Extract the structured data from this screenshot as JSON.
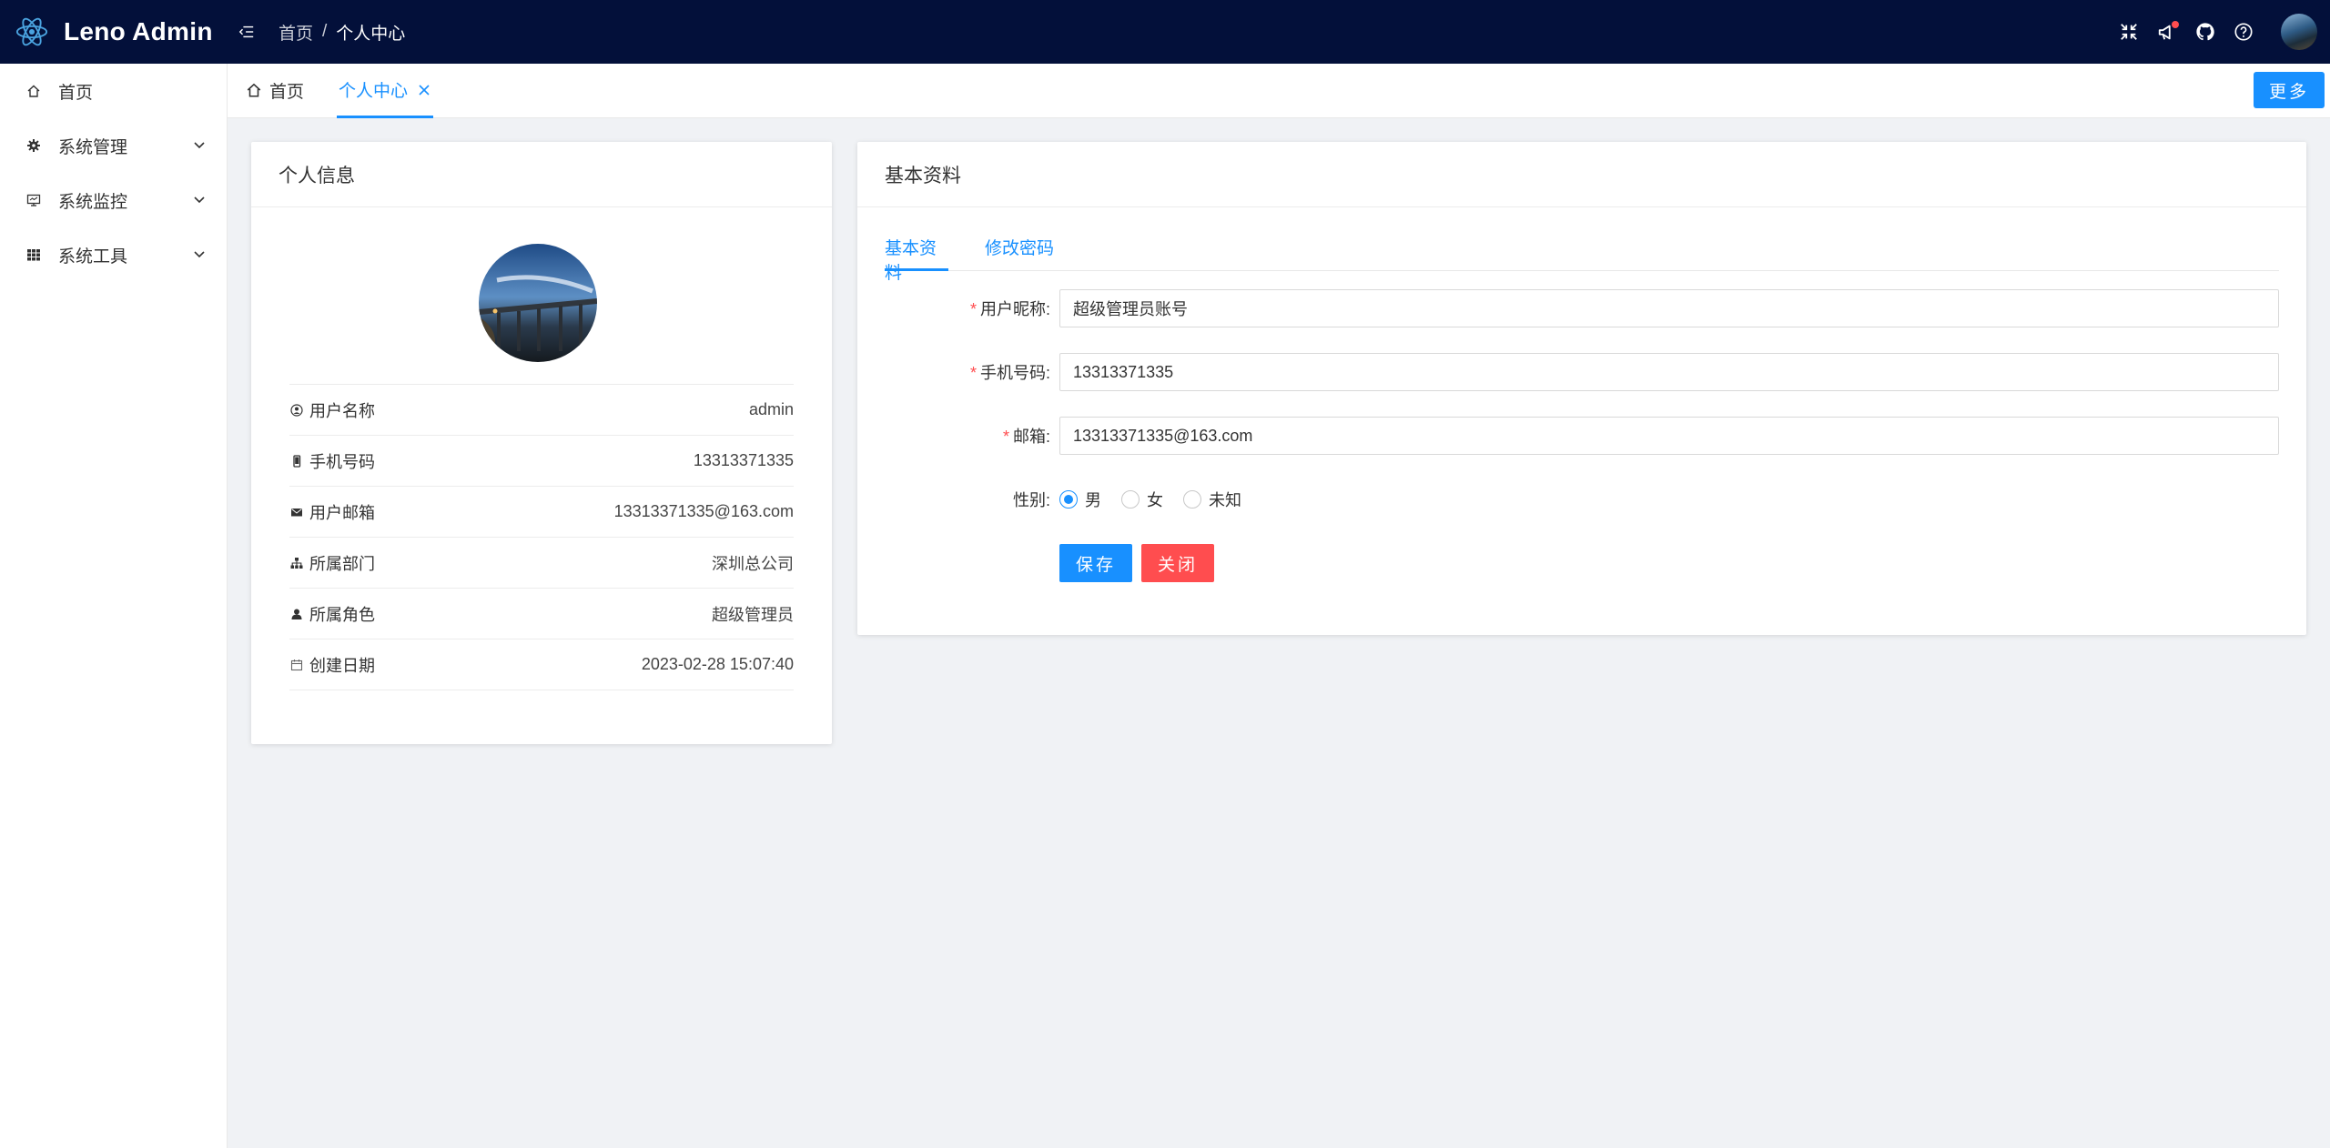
{
  "app": {
    "title": "Leno Admin",
    "colors": {
      "header_bg": "#03103a",
      "primary": "#1890ff",
      "danger": "#ff4d4f"
    }
  },
  "header": {
    "breadcrumb": {
      "home": "首页",
      "separator": "/",
      "current": "个人中心"
    },
    "icons": [
      "fullscreen-icon",
      "notification-icon",
      "github-icon",
      "help-icon"
    ],
    "has_notification_dot": true
  },
  "sidebar": {
    "items": [
      {
        "label": "首页",
        "icon": "home-icon",
        "expandable": false
      },
      {
        "label": "系统管理",
        "icon": "gear-icon",
        "expandable": true
      },
      {
        "label": "系统监控",
        "icon": "monitor-icon",
        "expandable": true
      },
      {
        "label": "系统工具",
        "icon": "grid-icon",
        "expandable": true
      }
    ]
  },
  "tabs": {
    "home": "首页",
    "active": "个人中心",
    "more_button": "更多"
  },
  "profile_card": {
    "title": "个人信息",
    "rows": [
      {
        "label": "用户名称",
        "value": "admin",
        "icon": "user-icon"
      },
      {
        "label": "手机号码",
        "value": "13313371335",
        "icon": "phone-icon"
      },
      {
        "label": "用户邮箱",
        "value": "13313371335@163.com",
        "icon": "mail-icon"
      },
      {
        "label": "所属部门",
        "value": "深圳总公司",
        "icon": "org-icon"
      },
      {
        "label": "所属角色",
        "value": "超级管理员",
        "icon": "role-icon"
      },
      {
        "label": "创建日期",
        "value": "2023-02-28 15:07:40",
        "icon": "calendar-icon"
      }
    ]
  },
  "basic_card": {
    "title": "基本资料",
    "subtabs": [
      "基本资料",
      "修改密码"
    ],
    "form": {
      "nickname": {
        "label": "用户昵称:",
        "value": "超级管理员账号",
        "required": true
      },
      "phone": {
        "label": "手机号码:",
        "value": "13313371335",
        "required": true
      },
      "email": {
        "label": "邮箱:",
        "value": "13313371335@163.com",
        "required": true
      },
      "gender": {
        "label": "性别:",
        "options": [
          "男",
          "女",
          "未知"
        ],
        "selected": "男"
      },
      "required_mark": "*",
      "save_label": "保存",
      "close_label": "关闭"
    }
  }
}
